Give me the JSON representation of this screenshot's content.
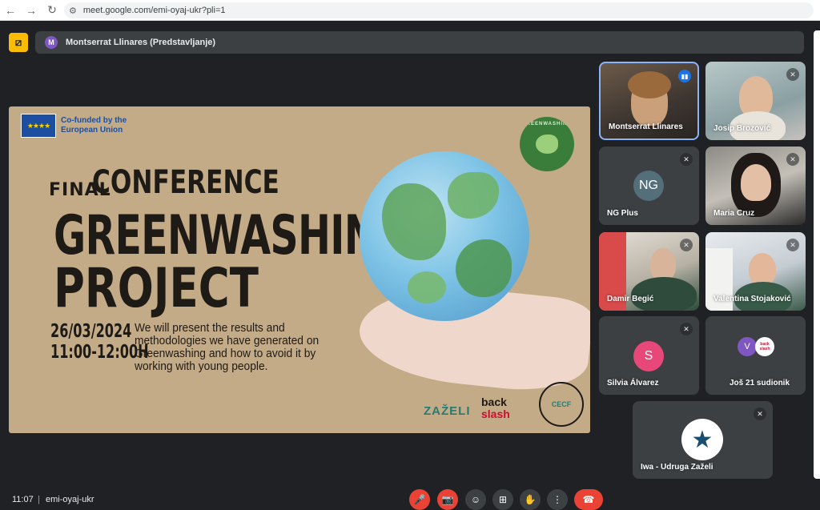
{
  "browser": {
    "back_icon": "←",
    "forward_icon": "→",
    "reload_icon": "↻",
    "url": "meet.google.com/emi-oyaj-ukr?pli=1"
  },
  "presenter": {
    "initial": "M",
    "label": "Montserrat Llinares (Predstavljanje)",
    "toggle_icon": "⧄"
  },
  "slide": {
    "eu_text": "Co-funded by the European Union",
    "eu_stars": "★★★★",
    "logo_text": "GREENWASHING",
    "title_final": "FINAL",
    "title_conference": "CONFERENCE",
    "title_greenwashing": "GREENWASHING",
    "title_project": "PROJECT",
    "date": "26/03/2024",
    "time": "11:00-12:00H",
    "description": "We will present the results and methodologies we have generated on Greenwashing and how to avoid it by working with young people.",
    "partner_zazeli": "ZAŽELI",
    "partner_back": "back",
    "partner_slash": "slash",
    "partner_cecf": "CECF"
  },
  "tiles": [
    {
      "name": "Montserrat Llinares"
    },
    {
      "name": "Josip Brozović"
    },
    {
      "name": "NG Plus",
      "initials": "NG"
    },
    {
      "name": "Maria Cruz"
    },
    {
      "name": "Damir Begić"
    },
    {
      "name": "Valentina Stojaković"
    },
    {
      "name": "Silvia Álvarez",
      "initials": "S"
    },
    {
      "name": "Još 21 sudionik",
      "initials": "V",
      "badge": "back slash"
    },
    {
      "name": "Iwa - Udruga Zaželi"
    }
  ],
  "icons": {
    "mic_off": "✕",
    "speaking": "▮▮"
  },
  "bottom": {
    "time": "11:07",
    "separator": "|",
    "meeting_code": "emi-oyaj-ukr"
  },
  "controls": {
    "mic": "🎤",
    "camera": "📷",
    "emoji": "☺",
    "present": "⊞",
    "hand": "✋",
    "more": "⋮",
    "end": "☎"
  },
  "colors": {
    "background": "#202124",
    "tile": "#3c4043",
    "accent_blue": "#1a73e8",
    "end_call_red": "#ea4335",
    "present_yellow": "#fbbc04"
  }
}
